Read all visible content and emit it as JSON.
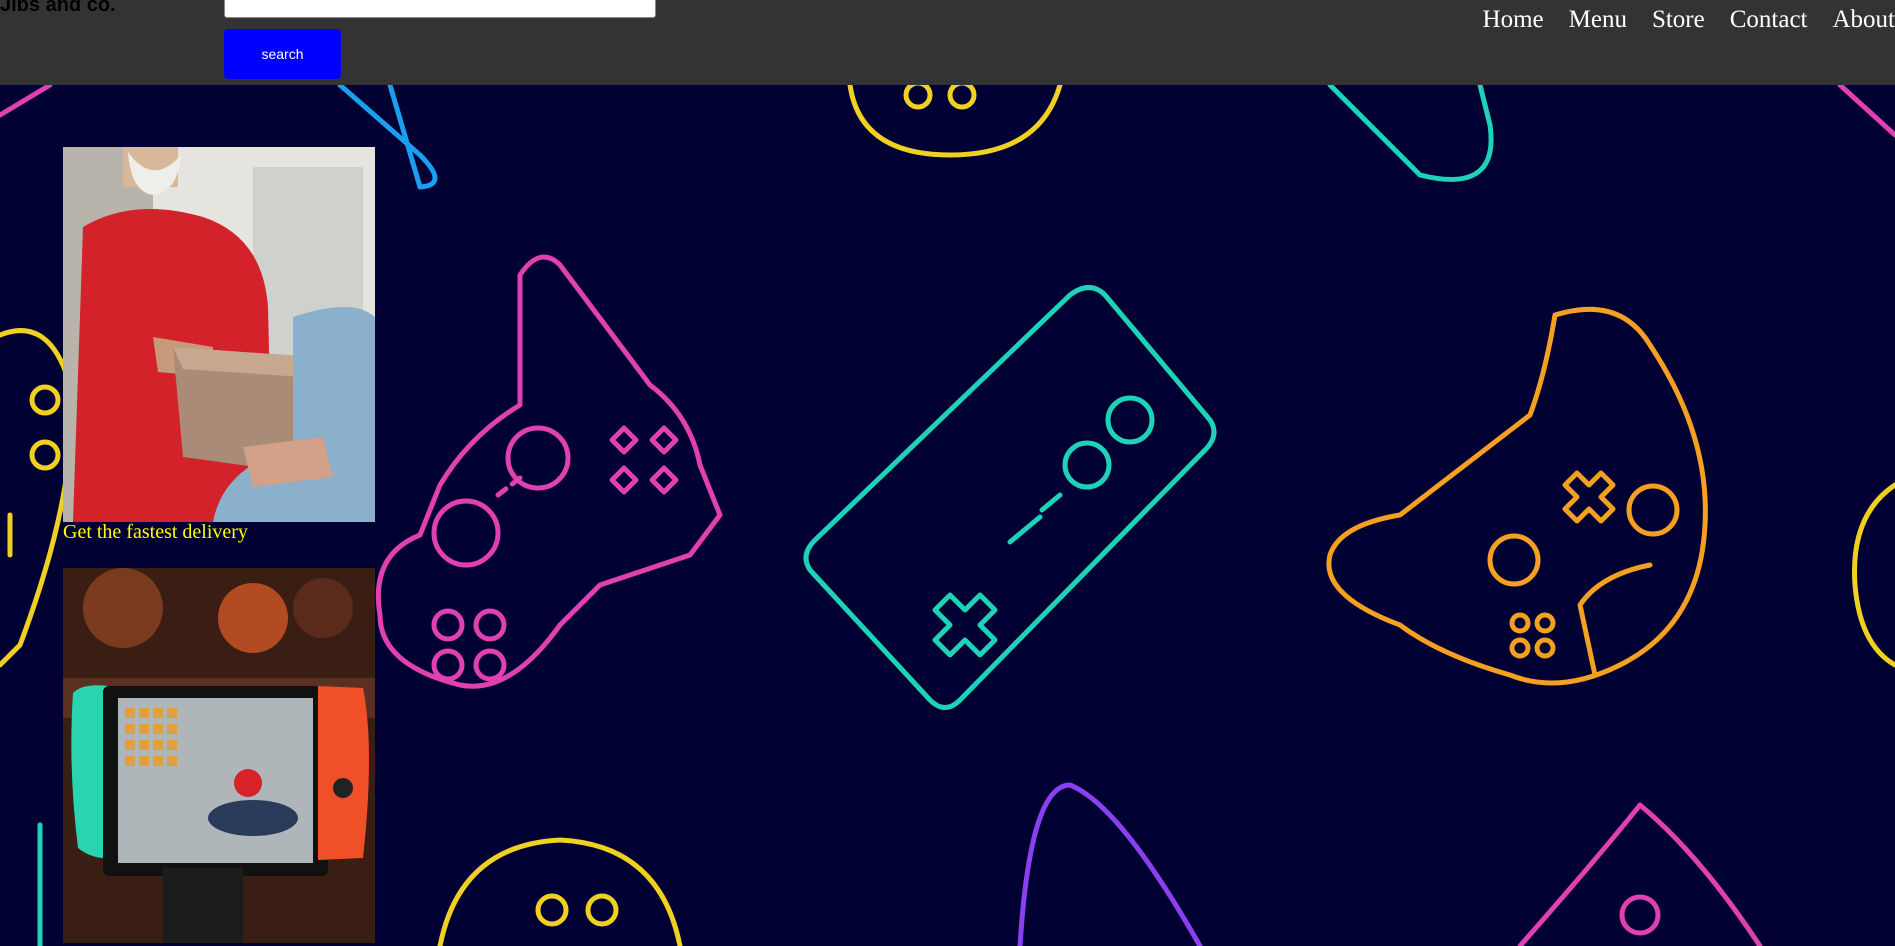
{
  "header": {
    "brand": "Jibs and co.",
    "search": {
      "button_label": "search",
      "value": ""
    },
    "nav": [
      "Home",
      "Menu",
      "Store",
      "Contact",
      "About"
    ]
  },
  "promos": [
    {
      "image": "delivery-photo",
      "caption": "Get the fastest delivery"
    },
    {
      "image": "nintendo-switch-photo"
    }
  ],
  "colors": {
    "header_bg": "#333333",
    "page_bg": "#010033",
    "search_button": "#0000ff",
    "caption": "#ffff00"
  }
}
